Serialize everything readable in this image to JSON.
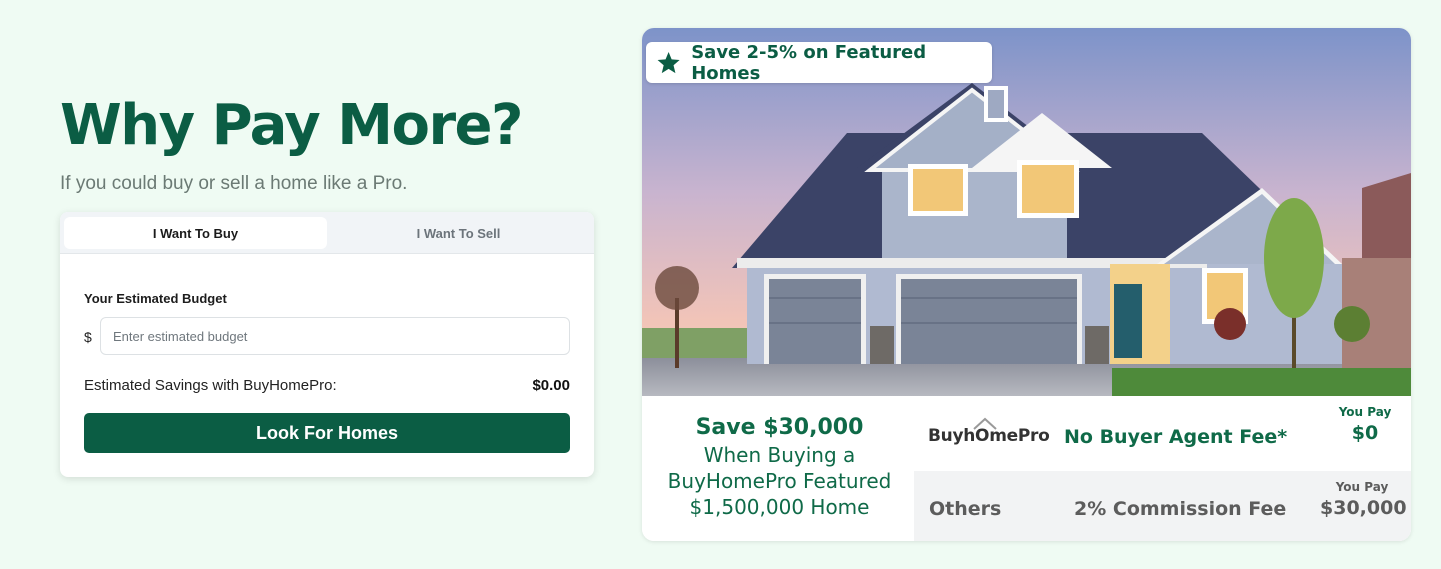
{
  "hero": {
    "headline": "Why Pay More?",
    "subheadline": "If you could buy or sell a home like a Pro."
  },
  "calculator": {
    "tabs": [
      {
        "label": "I Want To Buy",
        "active": true
      },
      {
        "label": "I Want To Sell",
        "active": false
      }
    ],
    "budget_label": "Your Estimated Budget",
    "currency_symbol": "$",
    "budget_placeholder": "Enter estimated budget",
    "budget_value": "",
    "savings_label": "Estimated Savings with BuyHomePro:",
    "savings_value": "$0.00",
    "cta_label": "Look For Homes"
  },
  "promo": {
    "badge_text": "Save 2-5% on Featured Homes",
    "badge_icon": "star-icon",
    "save_headline": "Save $30,000",
    "save_line2": "When Buying a",
    "save_line3": "BuyHomePro Featured",
    "save_line4": "$1,500,000 Home",
    "brand_logo": "BuyhOmePro",
    "brand_benefit": "No Buyer Agent Fee*",
    "brand_you_pay_label": "You Pay",
    "brand_you_pay_value": "$0",
    "others_label": "Others",
    "others_fee": "2% Commission Fee",
    "others_you_pay_label": "You Pay",
    "others_you_pay_value": "$30,000"
  },
  "colors": {
    "brand_green": "#0b5d44",
    "page_background": "#effbf3"
  }
}
